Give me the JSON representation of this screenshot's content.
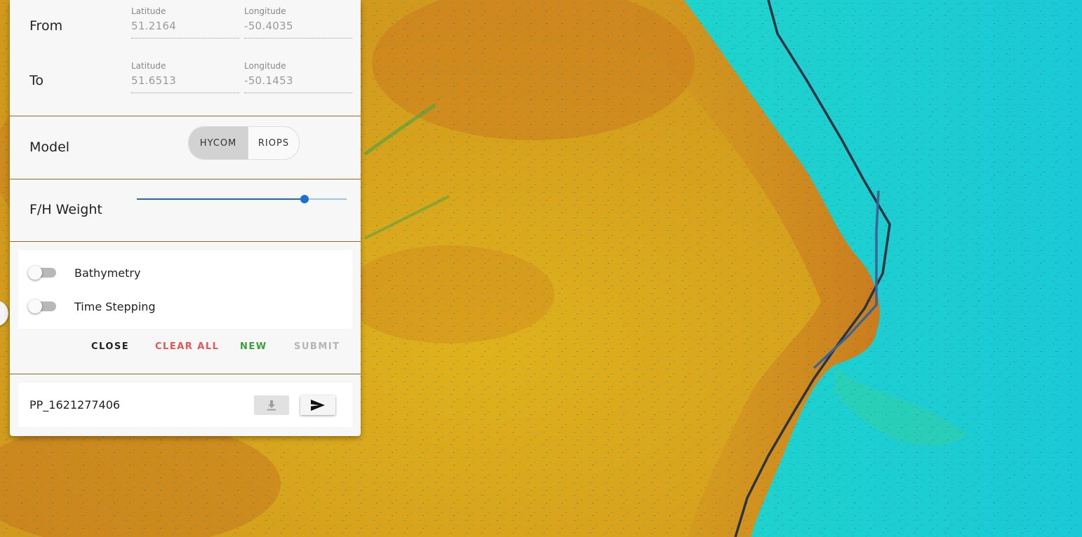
{
  "route": {
    "from": {
      "label": "From",
      "latitude_label": "Latitude",
      "latitude": "51.2164",
      "longitude_label": "Longitude",
      "longitude": "-50.4035"
    },
    "to": {
      "label": "To",
      "latitude_label": "Latitude",
      "latitude": "51.6513",
      "longitude_label": "Longitude",
      "longitude": "-50.1453"
    }
  },
  "model": {
    "label": "Model",
    "options": [
      "HYCOM",
      "RIOPS"
    ],
    "selected": "HYCOM"
  },
  "weight": {
    "label": "F/H Weight",
    "value_fraction": 0.8
  },
  "switches": {
    "bathymetry": {
      "label": "Bathymetry",
      "on": false
    },
    "time_stepping": {
      "label": "Time Stepping",
      "on": false
    }
  },
  "actions": {
    "close": "CLOSE",
    "clear_all": "CLEAR ALL",
    "new": "NEW",
    "submit": "SUBMIT"
  },
  "colors": {
    "clear_all": "#e05555",
    "new": "#3aa03a",
    "submit_disabled": "#b5b5b5",
    "slider_active": "#1d70d1",
    "land_yellow": "#d9a81a",
    "shelf_orange": "#c97a22",
    "ocean_cyan": "#19d3cc",
    "route_dark": "#2b3440",
    "route_blue": "#3e6494"
  },
  "saved_route": {
    "name": "PP_1621277406",
    "download_icon": "download-icon",
    "send_icon": "send-icon"
  }
}
